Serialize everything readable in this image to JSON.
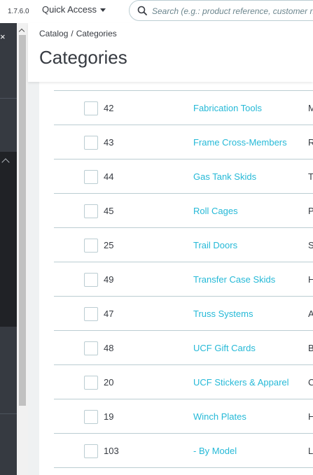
{
  "header": {
    "version": "1.7.6.0",
    "quick_access_label": "Quick Access",
    "search_placeholder": "Search (e.g.: product reference, customer name…)"
  },
  "breadcrumb": {
    "items": [
      "Catalog",
      "Categories"
    ],
    "separator": "/"
  },
  "page": {
    "title": "Categories"
  },
  "sidebar": {
    "close_glyph": "×"
  },
  "table": {
    "rows": [
      {
        "id": "42",
        "name": "Fabrication Tools",
        "desc_initial": "M"
      },
      {
        "id": "43",
        "name": "Frame Cross-Members",
        "desc_initial": "R"
      },
      {
        "id": "44",
        "name": "Gas Tank Skids",
        "desc_initial": "T"
      },
      {
        "id": "45",
        "name": "Roll Cages",
        "desc_initial": "P"
      },
      {
        "id": "25",
        "name": "Trail Doors",
        "desc_initial": "S"
      },
      {
        "id": "49",
        "name": "Transfer Case Skids",
        "desc_initial": "H"
      },
      {
        "id": "47",
        "name": "Truss Systems",
        "desc_initial": "A"
      },
      {
        "id": "48",
        "name": "UCF Gift Cards",
        "desc_initial": "B"
      },
      {
        "id": "20",
        "name": "UCF Stickers & Apparel",
        "desc_initial": "C"
      },
      {
        "id": "19",
        "name": "Winch Plates",
        "desc_initial": "H"
      },
      {
        "id": "103",
        "name": "- By Model",
        "desc_initial": "L"
      }
    ]
  },
  "colors": {
    "link": "#25b9d7",
    "sidebar": "#363a41",
    "border": "#bbcdd2",
    "text": "#363a41"
  },
  "icons": {
    "search": "search-icon",
    "caret": "caret-down-icon",
    "close": "close-icon",
    "collapse": "chevron-up-icon"
  }
}
